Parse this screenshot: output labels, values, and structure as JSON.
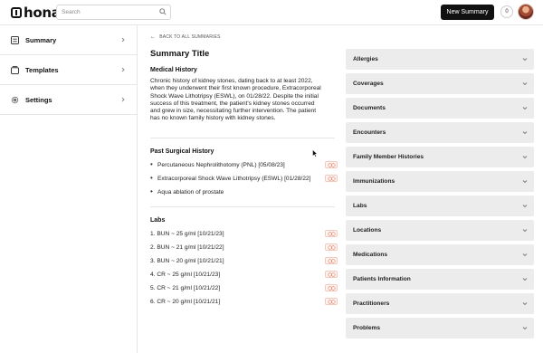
{
  "header": {
    "logo_text": "hona",
    "search_placeholder": "Search",
    "new_summary_label": "New Summary",
    "notification_count": "0"
  },
  "sidebar": {
    "items": [
      {
        "label": "Summary",
        "icon": "list-icon"
      },
      {
        "label": "Templates",
        "icon": "templates-icon"
      },
      {
        "label": "Settings",
        "icon": "gear-icon"
      }
    ]
  },
  "main": {
    "back_label": "BACK TO ALL SUMMARIES",
    "title": "Summary Title",
    "medical_history": {
      "heading": "Medical History",
      "text": "Chronic history of kidney stones, dating back to at least 2022, when they underwent their first known procedure, Extracorporeal Shock Wave Lithotripsy (ESWL), on 01/28/22. Despite the initial success of this treatment, the patient's kidney stones occurred and grew in size, necessitating further intervention. The patient has no known family history with kidney stones."
    },
    "surgical_history": {
      "heading": "Past Surgical History",
      "items": [
        "Percutaneous Nephrolithotomy (PNL) [05/08/23]",
        "Extracorporeal Shock Wave Lithotripsy (ESWL) [01/28/22]",
        "Aqua ablation of prostate"
      ]
    },
    "labs": {
      "heading": "Labs",
      "items": [
        "1. BUN ~ 25 g/ml [10/21/23]",
        "2. BUN ~ 21 g/ml [10/21/22]",
        "3. BUN ~ 20 g/ml [10/21/21]",
        "4. CR ~ 25 g/ml [10/21/23]",
        "5. CR ~ 21 g/ml [10/21/22]",
        "6. CR ~ 20 g/ml [10/21/21]"
      ]
    }
  },
  "accordion": {
    "items": [
      "Allergies",
      "Coverages",
      "Documents",
      "Encounters",
      "Family Member Histories",
      "Immunizations",
      "Labs",
      "Locations",
      "Medications",
      "Patients Information",
      "Practitioners",
      "Problems"
    ]
  },
  "colors": {
    "primary_button": "#111111",
    "accordion_bg": "#ececec",
    "link_badge_border": "#f3c9bd"
  }
}
